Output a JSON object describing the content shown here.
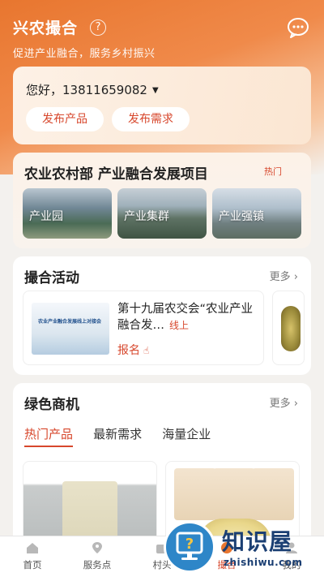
{
  "header": {
    "title": "兴农撮合",
    "subtitle": "促进产业融合，服务乡村振兴"
  },
  "user": {
    "greeting": "您好，13811659082",
    "actions": [
      "发布产品",
      "发布需求"
    ]
  },
  "project": {
    "title": "农业农村部 产业融合发展项目",
    "tag": "热门",
    "tiles": [
      "产业园",
      "产业集群",
      "产业强镇"
    ]
  },
  "activities": {
    "title": "撮合活动",
    "more": "更多 ›",
    "item": {
      "name": "第十九届农交会“农业产业融合发…",
      "status": "线上",
      "action": "报名",
      "thumb_caption": "农业产业融合发展线上对接会"
    }
  },
  "market": {
    "title": "绿色商机",
    "more": "更多 ›",
    "tabs": [
      "热门产品",
      "最新需求",
      "海量企业"
    ],
    "active_tab": 0
  },
  "nav": {
    "items": [
      "首页",
      "服务点",
      "村头",
      "撮合",
      "我的"
    ],
    "active": 3
  },
  "watermark": {
    "title": "知识屋",
    "url": "zhishiwu.com"
  },
  "colors": {
    "accent": "#d7472c",
    "header_orange": "#e8762f"
  }
}
